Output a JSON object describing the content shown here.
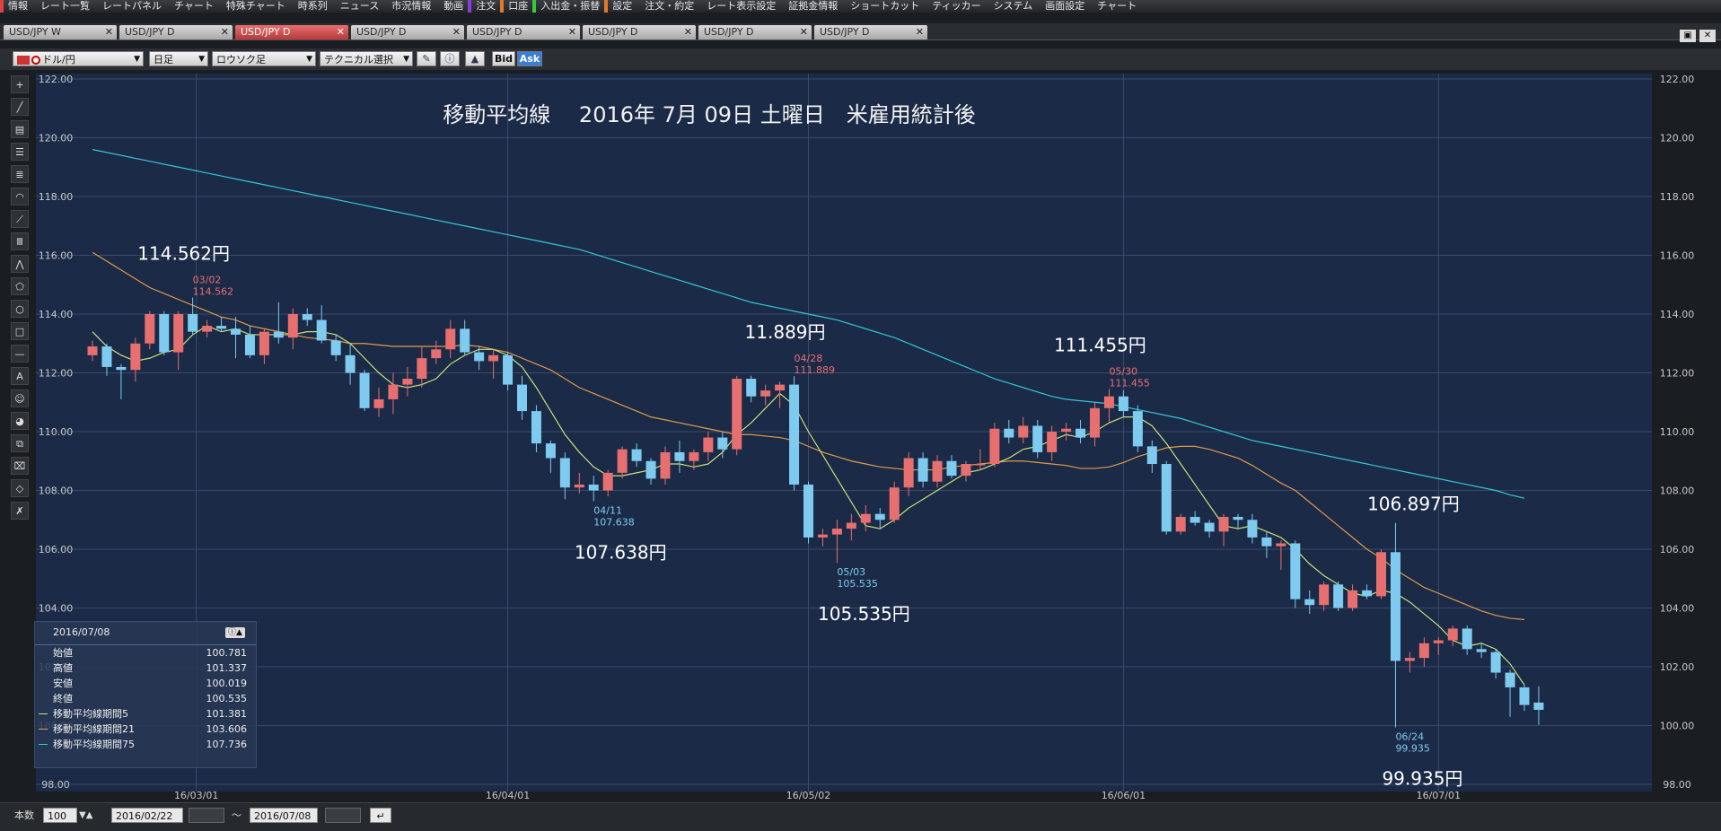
{
  "menu": [
    "情報",
    "レート一覧",
    "レートパネル",
    "チャート",
    "特殊チャート",
    "時系列",
    "ニュース",
    "市況情報",
    "動画",
    "注文",
    "口座",
    "入出金・振替",
    "設定",
    "注文・約定",
    "レート表示設定",
    "証拠金情報",
    "ショートカット",
    "ティッカー",
    "システム",
    "画面設定",
    "チャート"
  ],
  "tabs": [
    "USD/JPY W",
    "USD/JPY D",
    "USD/JPY D",
    "USD/JPY D",
    "USD/JPY D",
    "USD/JPY D",
    "USD/JPY D",
    "USD/JPY D"
  ],
  "active_tab_index": 2,
  "toolbar": {
    "pair": "ドル/円",
    "period": "日足",
    "chart_type": "ロウソク足",
    "technical": "テクニカル選択",
    "bid": "Bid",
    "ask": "Ask"
  },
  "title": "移動平均線　 2016年 7月 09日 土曜日　米雇用統計後",
  "info": {
    "date": "2016/07/08",
    "rows": [
      {
        "label": "始値",
        "value": "100.781"
      },
      {
        "label": "高値",
        "value": "101.337"
      },
      {
        "label": "安値",
        "value": "100.019"
      },
      {
        "label": "終値",
        "value": "100.535"
      },
      {
        "label": "移動平均線期間5",
        "value": "101.381"
      },
      {
        "label": "移動平均線期間21",
        "value": "103.606"
      },
      {
        "label": "移動平均線期間75",
        "value": "107.736"
      }
    ]
  },
  "statusbar": {
    "count_label": "本数",
    "count": "100",
    "from": "2016/02/22",
    "sep": "～",
    "to": "2016/07/08"
  },
  "colors": {
    "up": "#e86f6f",
    "down": "#7ecbef",
    "ma5": "#c8e07a",
    "ma21": "#e39a4c",
    "ma75": "#35c6d8",
    "bg": "#1a2a47"
  },
  "chart_data": {
    "type": "candlestick",
    "ylim": [
      98,
      122
    ],
    "yticks": [
      "98.00",
      "100.00",
      "102.00",
      "104.00",
      "106.00",
      "108.00",
      "110.00",
      "112.00",
      "114.00",
      "116.00",
      "118.00",
      "120.00",
      "122.00"
    ],
    "xticks": [
      {
        "label": "16/03/01",
        "i": 7
      },
      {
        "label": "16/04/01",
        "i": 29
      },
      {
        "label": "16/05/02",
        "i": 50
      },
      {
        "label": "16/06/01",
        "i": 72
      },
      {
        "label": "16/07/01",
        "i": 94
      }
    ],
    "candles": [
      [
        112.6,
        113.1,
        112.4,
        112.9
      ],
      [
        112.9,
        113.0,
        111.9,
        112.2
      ],
      [
        112.2,
        112.3,
        111.1,
        112.1
      ],
      [
        112.1,
        113.2,
        111.7,
        113.0
      ],
      [
        113.0,
        114.1,
        112.8,
        114.0
      ],
      [
        114.0,
        114.1,
        112.6,
        112.7
      ],
      [
        112.7,
        114.1,
        112.1,
        114.0
      ],
      [
        114.0,
        114.562,
        113.3,
        113.4
      ],
      [
        113.4,
        113.8,
        113.2,
        113.6
      ],
      [
        113.6,
        113.9,
        113.4,
        113.5
      ],
      [
        113.5,
        113.9,
        112.5,
        113.3
      ],
      [
        113.3,
        113.6,
        112.5,
        112.6
      ],
      [
        112.6,
        113.5,
        112.3,
        113.4
      ],
      [
        113.4,
        114.4,
        113.0,
        113.2
      ],
      [
        113.2,
        114.2,
        112.8,
        114.0
      ],
      [
        114.0,
        114.2,
        113.6,
        113.8
      ],
      [
        113.8,
        114.3,
        113.0,
        113.1
      ],
      [
        113.1,
        113.3,
        112.4,
        112.6
      ],
      [
        112.6,
        113.0,
        111.6,
        112.0
      ],
      [
        112.0,
        112.1,
        110.7,
        110.8
      ],
      [
        110.8,
        111.5,
        110.5,
        111.1
      ],
      [
        111.1,
        112.0,
        110.6,
        111.6
      ],
      [
        111.6,
        112.2,
        111.2,
        111.8
      ],
      [
        111.8,
        112.9,
        111.5,
        112.5
      ],
      [
        112.5,
        113.1,
        112.3,
        112.8
      ],
      [
        112.8,
        113.8,
        112.5,
        113.5
      ],
      [
        113.5,
        113.8,
        112.6,
        112.7
      ],
      [
        112.7,
        112.9,
        112.1,
        112.4
      ],
      [
        112.4,
        112.8,
        111.8,
        112.6
      ],
      [
        112.6,
        112.7,
        111.4,
        111.6
      ],
      [
        111.6,
        111.9,
        110.4,
        110.7
      ],
      [
        110.7,
        110.9,
        109.3,
        109.6
      ],
      [
        109.6,
        109.7,
        108.6,
        109.1
      ],
      [
        109.1,
        109.3,
        107.7,
        108.1
      ],
      [
        108.1,
        108.6,
        107.9,
        108.2
      ],
      [
        108.2,
        108.5,
        107.638,
        108.0
      ],
      [
        108.0,
        108.7,
        107.8,
        108.6
      ],
      [
        108.6,
        109.5,
        108.4,
        109.4
      ],
      [
        109.4,
        109.6,
        108.8,
        109.0
      ],
      [
        109.0,
        109.1,
        108.2,
        108.4
      ],
      [
        108.4,
        109.5,
        108.2,
        109.3
      ],
      [
        109.3,
        109.7,
        108.6,
        109.0
      ],
      [
        109.0,
        109.4,
        108.7,
        109.3
      ],
      [
        109.3,
        110.0,
        109.0,
        109.8
      ],
      [
        109.8,
        110.0,
        109.1,
        109.4
      ],
      [
        109.4,
        111.9,
        109.2,
        111.8
      ],
      [
        111.8,
        111.9,
        111.0,
        111.2
      ],
      [
        111.2,
        111.6,
        110.9,
        111.4
      ],
      [
        111.4,
        111.7,
        110.8,
        111.6
      ],
      [
        111.6,
        111.889,
        108.0,
        108.2
      ],
      [
        108.2,
        108.3,
        106.2,
        106.4
      ],
      [
        106.4,
        106.7,
        106.1,
        106.5
      ],
      [
        106.5,
        107.0,
        105.535,
        106.7
      ],
      [
        106.7,
        107.2,
        106.3,
        106.9
      ],
      [
        106.9,
        107.5,
        106.6,
        107.2
      ],
      [
        107.2,
        107.4,
        106.7,
        107.0
      ],
      [
        107.0,
        108.3,
        106.9,
        108.1
      ],
      [
        108.1,
        109.3,
        107.8,
        109.1
      ],
      [
        109.1,
        109.3,
        108.1,
        108.3
      ],
      [
        108.3,
        109.2,
        108.1,
        109.0
      ],
      [
        109.0,
        109.2,
        108.4,
        108.5
      ],
      [
        108.5,
        109.0,
        108.3,
        108.9
      ],
      [
        108.9,
        109.4,
        108.7,
        108.9
      ],
      [
        108.9,
        110.3,
        108.8,
        110.1
      ],
      [
        110.1,
        110.4,
        109.6,
        109.8
      ],
      [
        109.8,
        110.5,
        109.6,
        110.2
      ],
      [
        110.2,
        110.4,
        109.1,
        109.3
      ],
      [
        109.3,
        110.2,
        109.0,
        110.0
      ],
      [
        110.0,
        110.3,
        109.7,
        110.1
      ],
      [
        110.1,
        110.4,
        109.6,
        109.8
      ],
      [
        109.8,
        111.0,
        109.5,
        110.8
      ],
      [
        110.8,
        111.455,
        110.3,
        111.2
      ],
      [
        111.2,
        111.4,
        110.5,
        110.7
      ],
      [
        110.7,
        110.9,
        109.3,
        109.5
      ],
      [
        109.5,
        109.7,
        108.6,
        108.9
      ],
      [
        108.9,
        109.0,
        106.5,
        106.6
      ],
      [
        106.6,
        107.2,
        106.5,
        107.1
      ],
      [
        107.1,
        107.3,
        106.8,
        106.9
      ],
      [
        106.9,
        107.0,
        106.4,
        106.6
      ],
      [
        106.6,
        107.2,
        106.1,
        107.1
      ],
      [
        107.1,
        107.2,
        106.7,
        107.0
      ],
      [
        107.0,
        107.2,
        106.2,
        106.4
      ],
      [
        106.4,
        106.6,
        105.7,
        106.1
      ],
      [
        106.1,
        106.3,
        105.3,
        106.2
      ],
      [
        106.2,
        106.3,
        104.0,
        104.3
      ],
      [
        104.3,
        104.6,
        103.8,
        104.1
      ],
      [
        104.1,
        104.9,
        103.9,
        104.8
      ],
      [
        104.8,
        104.9,
        103.9,
        104.0
      ],
      [
        104.0,
        104.8,
        103.9,
        104.6
      ],
      [
        104.6,
        104.8,
        104.3,
        104.4
      ],
      [
        104.4,
        106.0,
        104.3,
        105.9
      ],
      [
        105.9,
        106.897,
        99.935,
        102.2
      ],
      [
        102.2,
        102.5,
        101.8,
        102.3
      ],
      [
        102.3,
        103.0,
        102.0,
        102.8
      ],
      [
        102.8,
        103.0,
        102.4,
        102.9
      ],
      [
        102.9,
        103.4,
        102.7,
        103.3
      ],
      [
        103.3,
        103.4,
        102.4,
        102.6
      ],
      [
        102.6,
        102.8,
        102.3,
        102.5
      ],
      [
        102.5,
        102.6,
        101.6,
        101.8
      ],
      [
        101.8,
        101.9,
        100.3,
        101.3
      ],
      [
        101.3,
        101.4,
        100.5,
        100.7
      ],
      [
        100.781,
        101.337,
        100.019,
        100.535
      ]
    ],
    "ma5": [
      113.4,
      112.9,
      112.6,
      112.4,
      112.5,
      112.7,
      112.8,
      113.3,
      113.6,
      113.4,
      113.5,
      113.3,
      113.3,
      113.3,
      113.3,
      113.4,
      113.4,
      113.3,
      113.0,
      112.5,
      112.0,
      111.6,
      111.5,
      111.6,
      111.8,
      112.3,
      112.6,
      112.8,
      112.8,
      112.6,
      112.2,
      111.5,
      110.7,
      109.9,
      109.3,
      108.8,
      108.5,
      108.5,
      108.6,
      108.7,
      108.9,
      108.9,
      108.8,
      108.9,
      109.3,
      109.9,
      110.3,
      110.8,
      111.3,
      110.9,
      110.0,
      109.2,
      108.4,
      107.6,
      106.8,
      106.7,
      107.0,
      107.4,
      107.7,
      108.0,
      108.3,
      108.6,
      108.7,
      108.9,
      109.1,
      109.4,
      109.5,
      109.7,
      109.9,
      109.8,
      110.0,
      110.3,
      110.5,
      110.5,
      110.2,
      109.6,
      108.9,
      108.2,
      107.5,
      106.8,
      106.7,
      106.8,
      106.6,
      106.4,
      106.0,
      105.5,
      105.1,
      104.8,
      104.5,
      104.4,
      104.6,
      104.5,
      104.2,
      103.8,
      103.4,
      102.9,
      102.7,
      102.8,
      102.6,
      102.1,
      101.381
    ],
    "ma21": [
      116.1,
      115.8,
      115.5,
      115.2,
      114.9,
      114.7,
      114.5,
      114.3,
      114.1,
      113.9,
      113.8,
      113.6,
      113.5,
      113.4,
      113.3,
      113.2,
      113.15,
      113.1,
      113.0,
      113.0,
      112.95,
      112.9,
      112.9,
      112.9,
      112.9,
      112.9,
      112.95,
      112.9,
      112.8,
      112.7,
      112.5,
      112.3,
      112.1,
      111.8,
      111.5,
      111.3,
      111.1,
      110.9,
      110.7,
      110.5,
      110.4,
      110.3,
      110.2,
      110.1,
      110.0,
      109.9,
      109.9,
      109.85,
      109.8,
      109.7,
      109.5,
      109.3,
      109.15,
      109.0,
      108.9,
      108.8,
      108.75,
      108.7,
      108.7,
      108.7,
      108.8,
      108.85,
      108.9,
      108.95,
      109.0,
      109.0,
      108.95,
      108.9,
      108.85,
      108.75,
      108.75,
      108.8,
      108.95,
      109.15,
      109.3,
      109.45,
      109.5,
      109.5,
      109.4,
      109.25,
      109.1,
      108.85,
      108.55,
      108.25,
      108.0,
      107.6,
      107.2,
      106.8,
      106.4,
      106.0,
      105.7,
      105.3,
      105.0,
      104.7,
      104.5,
      104.3,
      104.1,
      103.9,
      103.75,
      103.65,
      103.606
    ],
    "ma75": [
      119.6,
      119.5,
      119.4,
      119.3,
      119.2,
      119.1,
      119.0,
      118.9,
      118.8,
      118.7,
      118.6,
      118.5,
      118.4,
      118.3,
      118.2,
      118.1,
      118.0,
      117.9,
      117.8,
      117.7,
      117.6,
      117.5,
      117.4,
      117.3,
      117.2,
      117.1,
      117.0,
      116.9,
      116.8,
      116.7,
      116.6,
      116.5,
      116.4,
      116.3,
      116.2,
      116.05,
      115.9,
      115.75,
      115.6,
      115.45,
      115.3,
      115.15,
      115.0,
      114.85,
      114.7,
      114.55,
      114.4,
      114.3,
      114.2,
      114.1,
      114.0,
      113.9,
      113.8,
      113.65,
      113.5,
      113.35,
      113.2,
      113.0,
      112.8,
      112.6,
      112.4,
      112.2,
      112.0,
      111.8,
      111.65,
      111.5,
      111.35,
      111.2,
      111.1,
      111.05,
      111.0,
      110.95,
      110.85,
      110.75,
      110.65,
      110.55,
      110.45,
      110.3,
      110.15,
      110.0,
      109.85,
      109.7,
      109.6,
      109.5,
      109.4,
      109.3,
      109.2,
      109.1,
      109.0,
      108.9,
      108.8,
      108.7,
      108.6,
      108.5,
      108.4,
      108.3,
      108.2,
      108.1,
      108.0,
      107.85,
      107.736
    ],
    "annotations": [
      {
        "i": 7,
        "date": "03/02",
        "value": "114.562",
        "big": "114.562円",
        "kind": "high"
      },
      {
        "i": 35,
        "date": "04/11",
        "value": "107.638",
        "big": "107.638円",
        "kind": "low"
      },
      {
        "i": 49,
        "date": "04/28",
        "value": "111.889",
        "big": "11.889円",
        "kind": "high"
      },
      {
        "i": 52,
        "date": "05/03",
        "value": "105.535",
        "big": "105.535円",
        "kind": "low"
      },
      {
        "i": 71,
        "date": "05/30",
        "value": "111.455",
        "big": "111.455円",
        "kind": "high"
      },
      {
        "i": 91,
        "date": "06/24",
        "value": "99.935",
        "big": "99.935円",
        "kind": "low"
      },
      {
        "i": 91,
        "date": "",
        "value": "",
        "big": "106.897円",
        "kind": "highbig"
      }
    ]
  }
}
